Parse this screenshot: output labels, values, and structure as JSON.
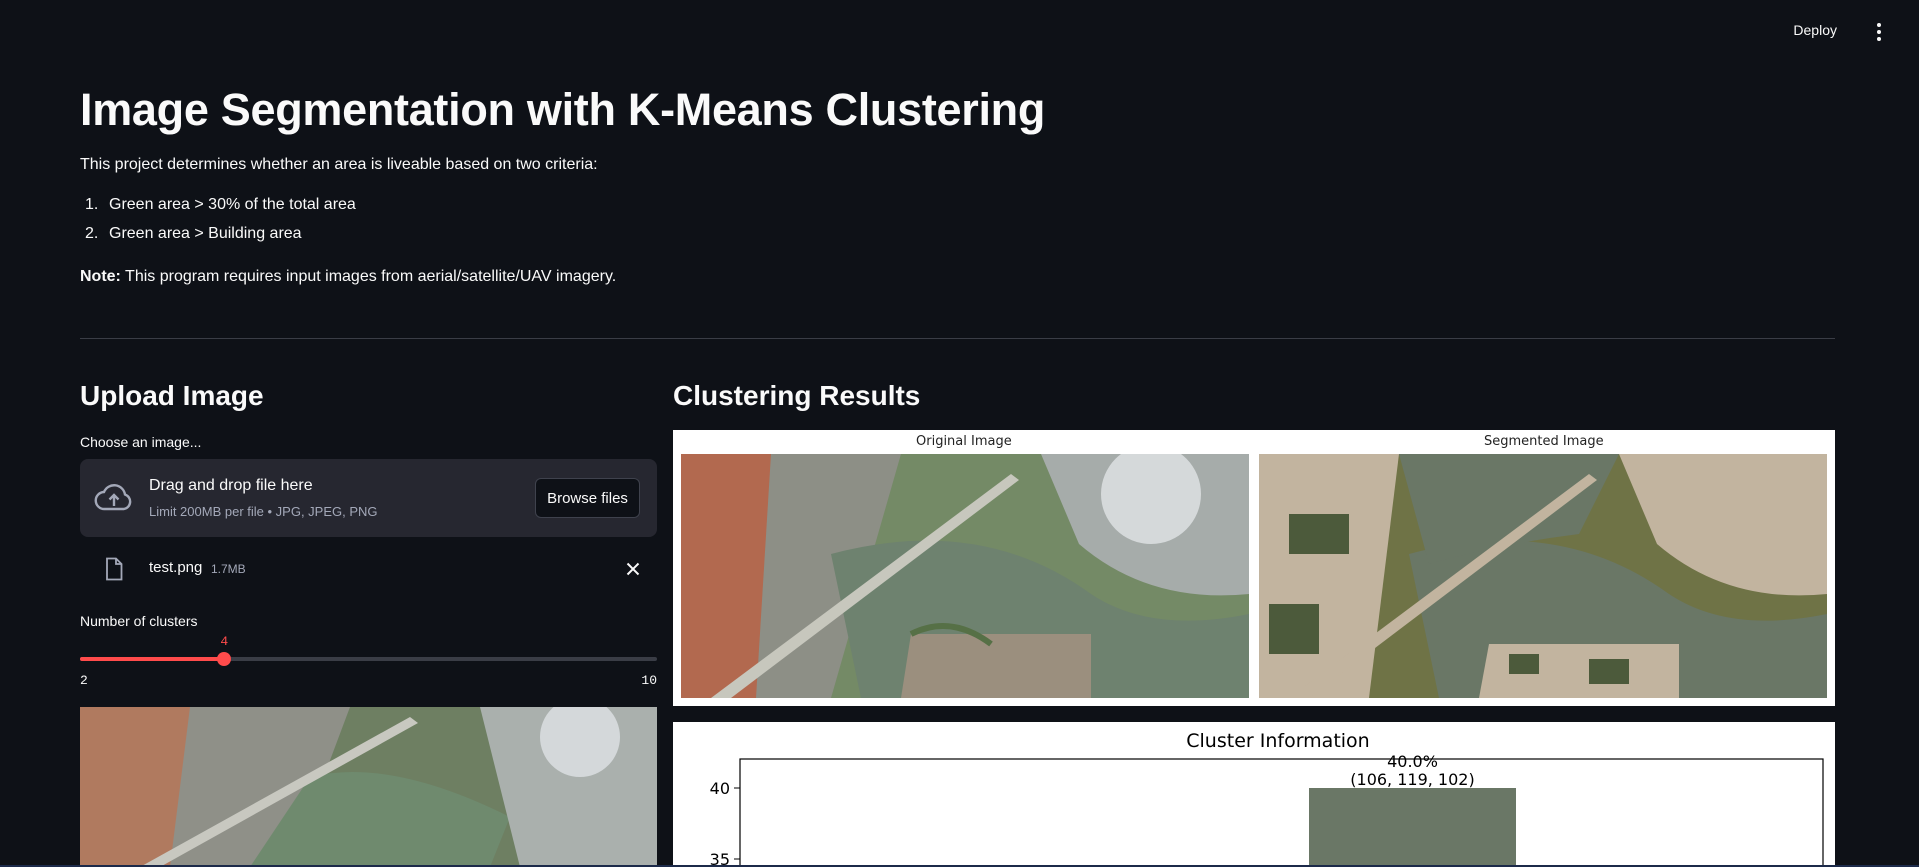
{
  "header": {
    "deploy_label": "Deploy",
    "menu_icon": "vertical-ellipsis-icon"
  },
  "page": {
    "title": "Image Segmentation with K-Means Clustering",
    "intro": "This project determines whether an area is liveable based on two criteria:",
    "criteria": [
      {
        "num": "1.",
        "text": "Green area > 30% of the total area"
      },
      {
        "num": "2.",
        "text": "Green area > Building area"
      }
    ],
    "note_label": "Note:",
    "note_text": " This program requires input images from aerial/satellite/UAV imagery."
  },
  "upload": {
    "heading": "Upload Image",
    "choose_label": "Choose an image...",
    "drop_main": "Drag and drop file here",
    "drop_sub": "Limit 200MB per file • JPG, JPEG, PNG",
    "browse_label": "Browse files",
    "file": {
      "name": "test.png",
      "size": "1.7MB"
    },
    "slider": {
      "label": "Number of clusters",
      "value": 4,
      "min": 2,
      "max": 10,
      "value_text": "4",
      "min_text": "2",
      "max_text": "10"
    }
  },
  "results": {
    "heading": "Clustering Results",
    "original_caption": "Original Image",
    "segmented_caption": "Segmented Image"
  },
  "colors": {
    "accent": "#ff4b4b",
    "background": "#0e1117",
    "panel": "#262730",
    "segment_green": "#6a7766",
    "segment_beige": "#c2b49f",
    "segment_olive": "#6f7346",
    "segment_dark": "#4c5a3b"
  },
  "chart_data": {
    "type": "bar",
    "title": "Cluster Information",
    "ylim": [
      33,
      42
    ],
    "yticks": [
      35,
      40
    ],
    "visible_bars": [
      {
        "value": 40.0,
        "label": "40.0%",
        "rgb_label": "(106, 119, 102)",
        "color": "#6a7766"
      }
    ]
  }
}
